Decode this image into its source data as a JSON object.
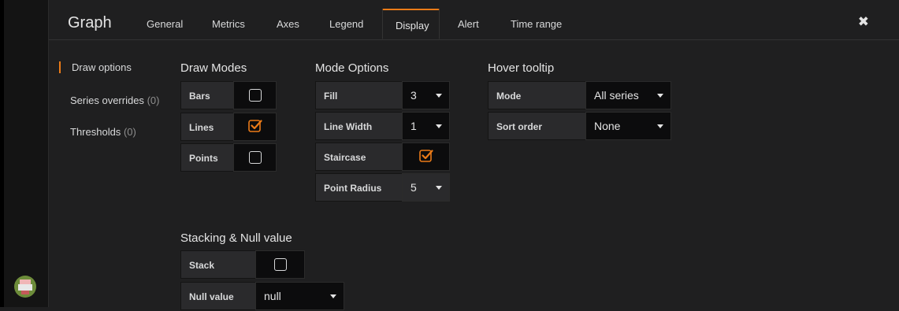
{
  "panel": {
    "title": "Graph"
  },
  "tabs": [
    {
      "label": "General"
    },
    {
      "label": "Metrics"
    },
    {
      "label": "Axes"
    },
    {
      "label": "Legend"
    },
    {
      "label": "Display"
    },
    {
      "label": "Alert"
    },
    {
      "label": "Time range"
    }
  ],
  "side_nav": {
    "draw_options": "Draw options",
    "series_overrides": {
      "label": "Series overrides",
      "count": "(0)"
    },
    "thresholds": {
      "label": "Thresholds",
      "count": "(0)"
    }
  },
  "draw_modes": {
    "heading": "Draw Modes",
    "bars": {
      "label": "Bars",
      "checked": false
    },
    "lines": {
      "label": "Lines",
      "checked": true
    },
    "points": {
      "label": "Points",
      "checked": false
    }
  },
  "mode_options": {
    "heading": "Mode Options",
    "fill": {
      "label": "Fill",
      "value": "3"
    },
    "line_width": {
      "label": "Line Width",
      "value": "1"
    },
    "staircase": {
      "label": "Staircase",
      "checked": true
    },
    "point_radius": {
      "label": "Point Radius",
      "value": "5"
    }
  },
  "hover_tooltip": {
    "heading": "Hover tooltip",
    "mode": {
      "label": "Mode",
      "value": "All series"
    },
    "sort_order": {
      "label": "Sort order",
      "value": "None"
    }
  },
  "stacking": {
    "heading": "Stacking & Null value",
    "stack": {
      "label": "Stack",
      "checked": false
    },
    "null_value": {
      "label": "Null value",
      "value": "null"
    }
  },
  "colors": {
    "accent": "#eb7b18",
    "background": "#1f1f20"
  }
}
